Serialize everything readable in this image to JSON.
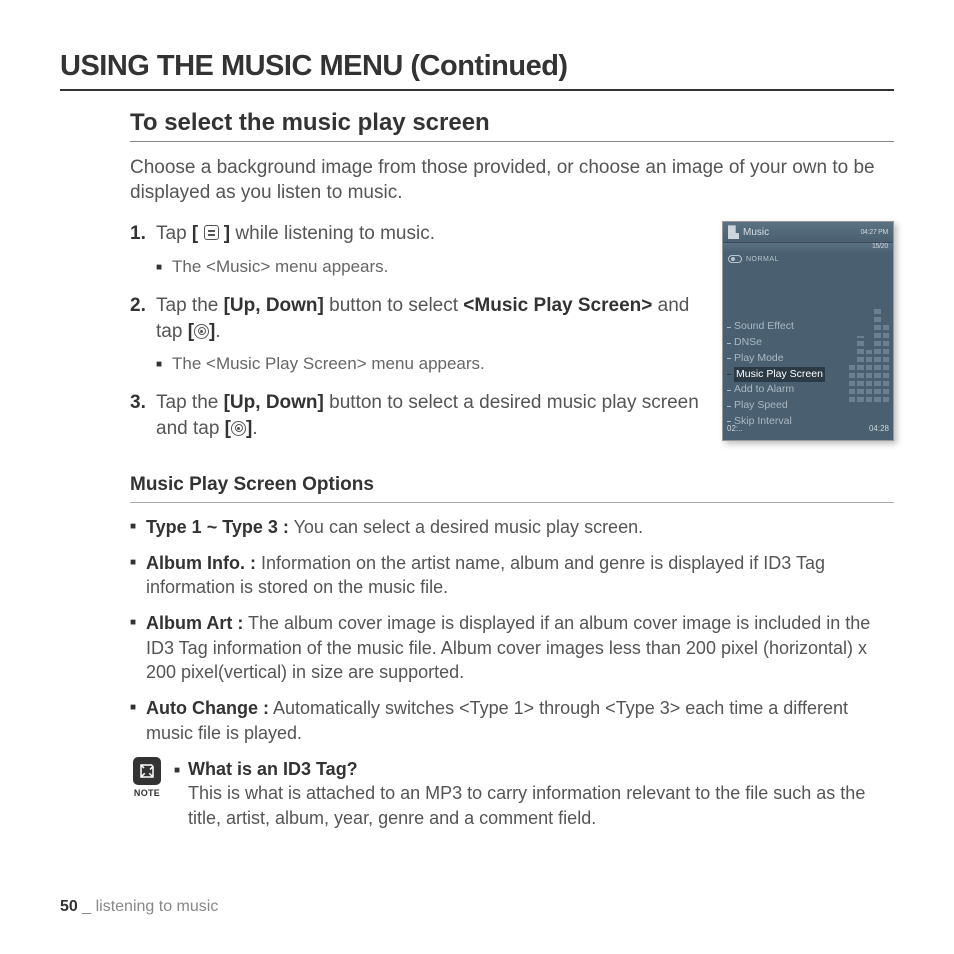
{
  "title": "USING THE MUSIC MENU (Continued)",
  "section_title": "To select the music play screen",
  "intro": "Choose a background image from those provided, or choose an image of your own to be displayed as you listen to music.",
  "steps": {
    "s1_num": "1.",
    "s1_a": "Tap ",
    "s1_b": " while listening to music.",
    "s1_sub": "The <Music> menu appears.",
    "s2_num": "2.",
    "s2_a": "Tap the ",
    "s2_b": "[Up, Down]",
    "s2_c": " button to select ",
    "s2_d": "<Music Play Screen>",
    "s2_e": " and tap ",
    "s2_f": ".",
    "s2_sub": "The <Music Play Screen> menu appears.",
    "s3_num": "3.",
    "s3_a": "Tap the ",
    "s3_b": "[Up, Down]",
    "s3_c": " button to select a desired music play screen and tap ",
    "s3_d": "."
  },
  "device": {
    "app": "Music",
    "time": "04:27 PM",
    "count": "15/20",
    "mode": "NORMAL",
    "menu": [
      "Sound Effect",
      "DNSe",
      "Play Mode",
      "Music Play Screen",
      "Add to Alarm",
      "Play Speed",
      "Skip Interval"
    ],
    "active_index": 3,
    "pos_left": "02:..",
    "pos_right": "04:28"
  },
  "subsection": "Music Play Screen Options",
  "options": {
    "o1_label": "Type 1 ~ Type 3 :",
    "o1_text": " You can select a desired music play screen.",
    "o2_label": "Album Info. :",
    "o2_text": " Information on the artist name, album and genre is displayed if ID3 Tag information is stored on the music file.",
    "o3_label": "Album Art :",
    "o3_text": " The album cover image is displayed if an album cover image is included in the ID3 Tag information of the music file. Album cover images less than 200 pixel (horizontal) x 200 pixel(vertical) in size are supported.",
    "o4_label": "Auto Change :",
    "o4_text": " Automatically switches <Type 1> through <Type 3> each time a different music file is played."
  },
  "note": {
    "label": "NOTE",
    "q": "What is an ID3 Tag?",
    "a": "This is what is attached to an MP3 to carry information relevant to the file such as the title, artist, album, year, genre and a comment field."
  },
  "footer": {
    "page": "50",
    "sep": " _ ",
    "chapter": "listening to music"
  },
  "bracket_open": "[ ",
  "bracket_close": " ]",
  "bracket_open2": "[",
  "bracket_close2": "]"
}
